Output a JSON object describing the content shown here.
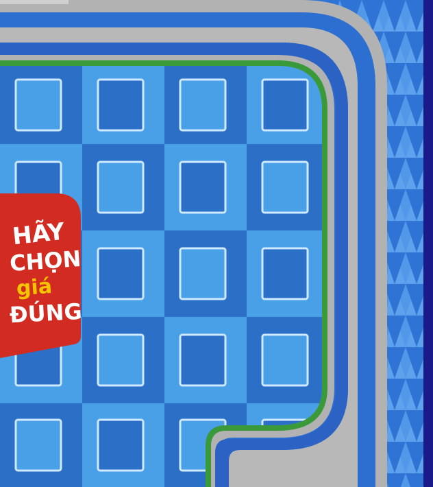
{
  "logo": {
    "line1": "HÃY",
    "line2": "CHỌN",
    "line3": "giá",
    "line4": "ĐÚNG"
  },
  "colors": {
    "tile_dark": "#2b6fc6",
    "tile_light": "#4aa0e6",
    "card_border": "#cfe9ff",
    "track_gray": "#b2b2b2",
    "track_blue": "#2c6fd1",
    "green_rim": "#3a9a3a",
    "pattern_base": "#3a7fdc",
    "right_edge": "#1b1a8a",
    "logo_red": "#d12b22",
    "logo_yellow": "#f5c400"
  },
  "icons": [
    "game-logo-icon"
  ]
}
